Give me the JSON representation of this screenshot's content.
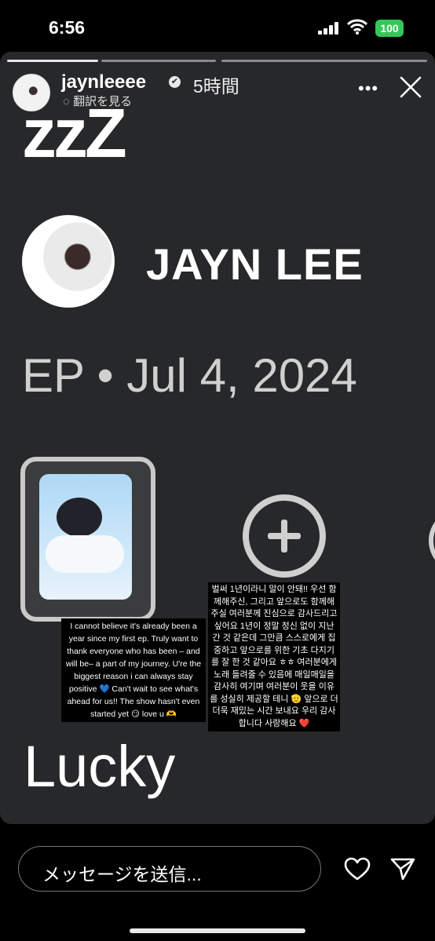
{
  "status_bar": {
    "time": "6:56",
    "battery": "100"
  },
  "story": {
    "username": "jaynleeee",
    "verified_mark": "✔",
    "posted_ago": "5時間",
    "translate_label": "翻訳を見る",
    "more_label": "•••"
  },
  "post": {
    "zzz_title": "zzZ",
    "artist_name": "JAYN LEE",
    "release_line": "EP • Jul 4, 2024",
    "caption_en": "I cannot believe it's already been a year since my first ep. Truly want to thank everyone who has been – and will be– a part of my journey. U're the biggest reason i can always stay positive 💙 Can't wait to see what's ahead for us!! The show hasn't even started yet 😏 love u 🫶",
    "caption_ko": "벌써 1년이라니 말이 안돼!! 우선 함께해주신, 그리고 앞으로도 함께해주실 여러분께 진심으로 감사드리고 싶어요 1년이 정말 정신 없이 지난 간 것 같은데 그만큼 스스로에게 집중하고 앞으로를 위한 기초 다지기를 잘 한 것 같아요 ㅎㅎ 여러분에게 노래 들려줄 수 있음에 매일매일을 감사히 여기며 여러분이 웃을 이유를 성실히 제공할 테니 🫡 앞으로 더더욱 재밌는 시간 보내요 우리 감사합니다 사랑해요 ❤️",
    "lucky_text": "Lucky"
  },
  "message_bar": {
    "placeholder": "メッセージを送信..."
  },
  "colors": {
    "battery": "#34c759",
    "story_bg": "#26282a"
  }
}
